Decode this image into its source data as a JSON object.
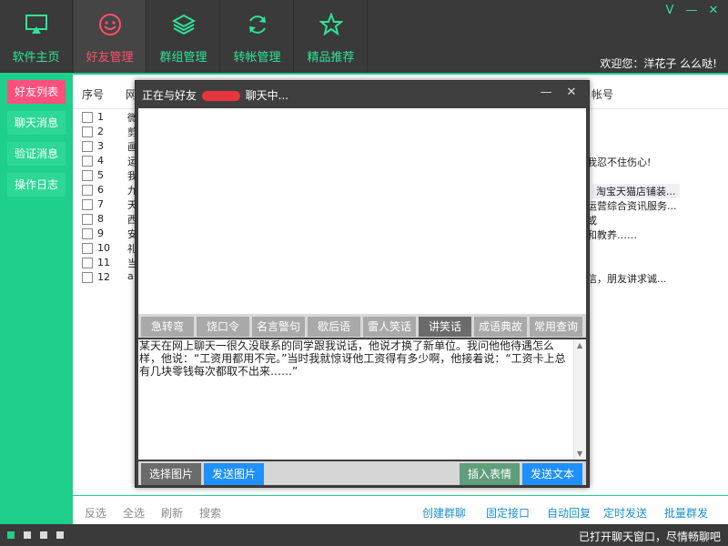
{
  "nav": {
    "items": [
      {
        "label": "软件主页",
        "icon": "monitor-icon"
      },
      {
        "label": "好友管理",
        "icon": "smiley-icon"
      },
      {
        "label": "群组管理",
        "icon": "layers-icon"
      },
      {
        "label": "转帐管理",
        "icon": "refresh-icon"
      },
      {
        "label": "精品推荐",
        "icon": "star-icon"
      }
    ],
    "active": "好友管理",
    "welcome": "欢迎您：洋花子 么么哒!",
    "window_controls": {
      "minimize": "V",
      "restore": "—",
      "close": "✕"
    }
  },
  "sidebar": {
    "items": [
      {
        "label": "好友列表"
      },
      {
        "label": "聊天消息"
      },
      {
        "label": "验证消息"
      },
      {
        "label": "操作日志"
      }
    ]
  },
  "list": {
    "headers": {
      "index": "序号",
      "col1": "网",
      "col2": "帐号"
    },
    "rows": [
      {
        "num": "1",
        "c1": "微",
        "c2": ""
      },
      {
        "num": "2",
        "c1": "剪",
        "c2": ""
      },
      {
        "num": "3",
        "c1": "画",
        "c2": ""
      },
      {
        "num": "4",
        "c1": "运",
        "c2": "我忍不住伤心!"
      },
      {
        "num": "5",
        "c1": "我",
        "c2": ""
      },
      {
        "num": "6",
        "c1": "九",
        "c2": "淘宝天猫店铺装..."
      },
      {
        "num": "7",
        "c1": "天",
        "c2": "运营综合资讯服务..."
      },
      {
        "num": "8",
        "c1": "西",
        "c2": "或"
      },
      {
        "num": "9",
        "c1": "安",
        "c2": "和教养……"
      },
      {
        "num": "10",
        "c1": "礼",
        "c2": ""
      },
      {
        "num": "11",
        "c1": "当",
        "c2": ""
      },
      {
        "num": "12",
        "c1": "a",
        "c2": "信，朋友讲求诚..."
      }
    ],
    "bottom_left": [
      "反选",
      "全选",
      "刷新",
      "搜索"
    ],
    "bottom_right": [
      "创建群聊",
      "固定接口",
      "自动回复",
      "定时发送",
      "批量群发"
    ]
  },
  "dialog": {
    "title_prefix": "正在与好友",
    "title_suffix": "聊天中...",
    "controls": {
      "minimize": "—",
      "close": "✕"
    },
    "tabs": [
      "急转弯",
      "饶口令",
      "名言警句",
      "歇后语",
      "雷人笑话",
      "讲笑话",
      "成语典故",
      "常用查询"
    ],
    "active_tab": "讲笑话",
    "input_text": "某天在网上聊天一很久没联系的同学跟我说话，他说才换了新单位。我问他他待遇怎么样，他说：“工资用都用不完。”当时我就惊讶他工资得有多少啊，他接着说：“工资卡上总有几块零钱每次都取不出来……”",
    "buttons": {
      "select_image": "选择图片",
      "send_image": "发送图片",
      "insert_emoji": "插入表情",
      "send_text": "发送文本"
    }
  },
  "status": {
    "text": "已打开聊天窗口，尽情畅聊吧"
  },
  "colors": {
    "accent": "#1fcf8c",
    "pink": "#ff4f7e",
    "dark": "#3a3a3a",
    "blue_button": "#1e90ff",
    "link_blue": "#1b90cf"
  }
}
